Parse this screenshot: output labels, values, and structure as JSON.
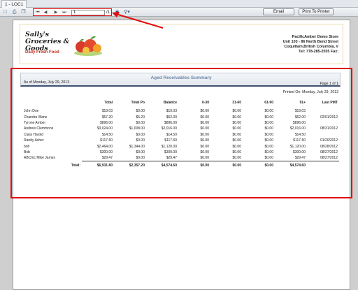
{
  "window": {
    "tab_title": "1 - LOC1"
  },
  "toolbar": {
    "icons": [
      "export-icon",
      "print-icon",
      "copy-icon"
    ],
    "nav": {
      "first": "⏮",
      "prev": "◀",
      "next": "▶",
      "last": "⏭"
    },
    "page_input": "1",
    "page_total": "/1",
    "search_icon": "binoculars-icon",
    "zoom_icon": "zoom-icon",
    "email_label": "Email",
    "print_label": "Print To Printer"
  },
  "header": {
    "logo_name": "Sally's Groceries & Goods",
    "logo_tagline": "Daily Fresh Food",
    "store_lines": [
      "PacificAmber Demo Store",
      "Unit 103 - 86 North Bend Street",
      "Coquitlam,British Columbia, V",
      "Tel: 778-285-2555  Fax:"
    ]
  },
  "report": {
    "title": "Aged Receivables Summary",
    "as_of": "As of Monday, July 29, 2013",
    "page_of": "Page 1 of 1",
    "printed_on": "Printed On: Monday, July 29, 2013",
    "columns": [
      "",
      "Total",
      "Total Po",
      "Balance",
      "0-30",
      "31-60",
      "61-90",
      "91+",
      "Last PMT"
    ],
    "rows": [
      [
        "John Doe",
        "$19.03",
        "$0.00",
        "$19.03",
        "$0.00",
        "$0.00",
        "$0.00",
        "$19.03",
        ""
      ],
      [
        "Chandra Wane",
        "$67.20",
        "$5.20",
        "$62.00",
        "$0.00",
        "$0.00",
        "$0.00",
        "$62.00",
        "02/01/2012"
      ],
      [
        "Tyrone Amber",
        "$896.00",
        "$0.00",
        "$896.00",
        "$0.00",
        "$0.00",
        "$0.00",
        "$896.00",
        ""
      ],
      [
        "Andrew Clemmons",
        "$3,024.00",
        "$1,008.00",
        "$2,016.00",
        "$0.00",
        "$0.00",
        "$0.00",
        "$2,016.00",
        "08/31/2012"
      ],
      [
        "Clara Harold",
        "$14.50",
        "$0.00",
        "$14.50",
        "$0.00",
        "$0.00",
        "$0.00",
        "$14.50",
        ""
      ],
      [
        "Randy Asher",
        "$117.60",
        "$0.00",
        "$117.60",
        "$0.00",
        "$0.00",
        "$0.00",
        "$117.60",
        "01/20/2012"
      ],
      [
        "bob",
        "$2,464.00",
        "$1,344.00",
        "$1,120.00",
        "$0.00",
        "$0.00",
        "$0.00",
        "$1,120.00",
        "08/28/2012"
      ],
      [
        "Bob",
        "$300.00",
        "$0.00",
        "$300.00",
        "$0.00",
        "$0.00",
        "$0.00",
        "$300.00",
        "08/27/2012"
      ],
      [
        "ABCInc Mike James",
        "$29.47",
        "$0.00",
        "$29.47",
        "$0.00",
        "$0.00",
        "$0.00",
        "$29.47",
        "08/27/2012"
      ]
    ],
    "totals": {
      "label": "Total:",
      "values": [
        "$6,931.80",
        "$2,357.20",
        "$4,574.60",
        "$0.00",
        "$0.00",
        "$0.00",
        "$4,574.60",
        ""
      ]
    }
  },
  "colors": {
    "annotation_red": "#e01010",
    "summary_title": "#6f87aa",
    "tagline_red": "#c0301e"
  }
}
